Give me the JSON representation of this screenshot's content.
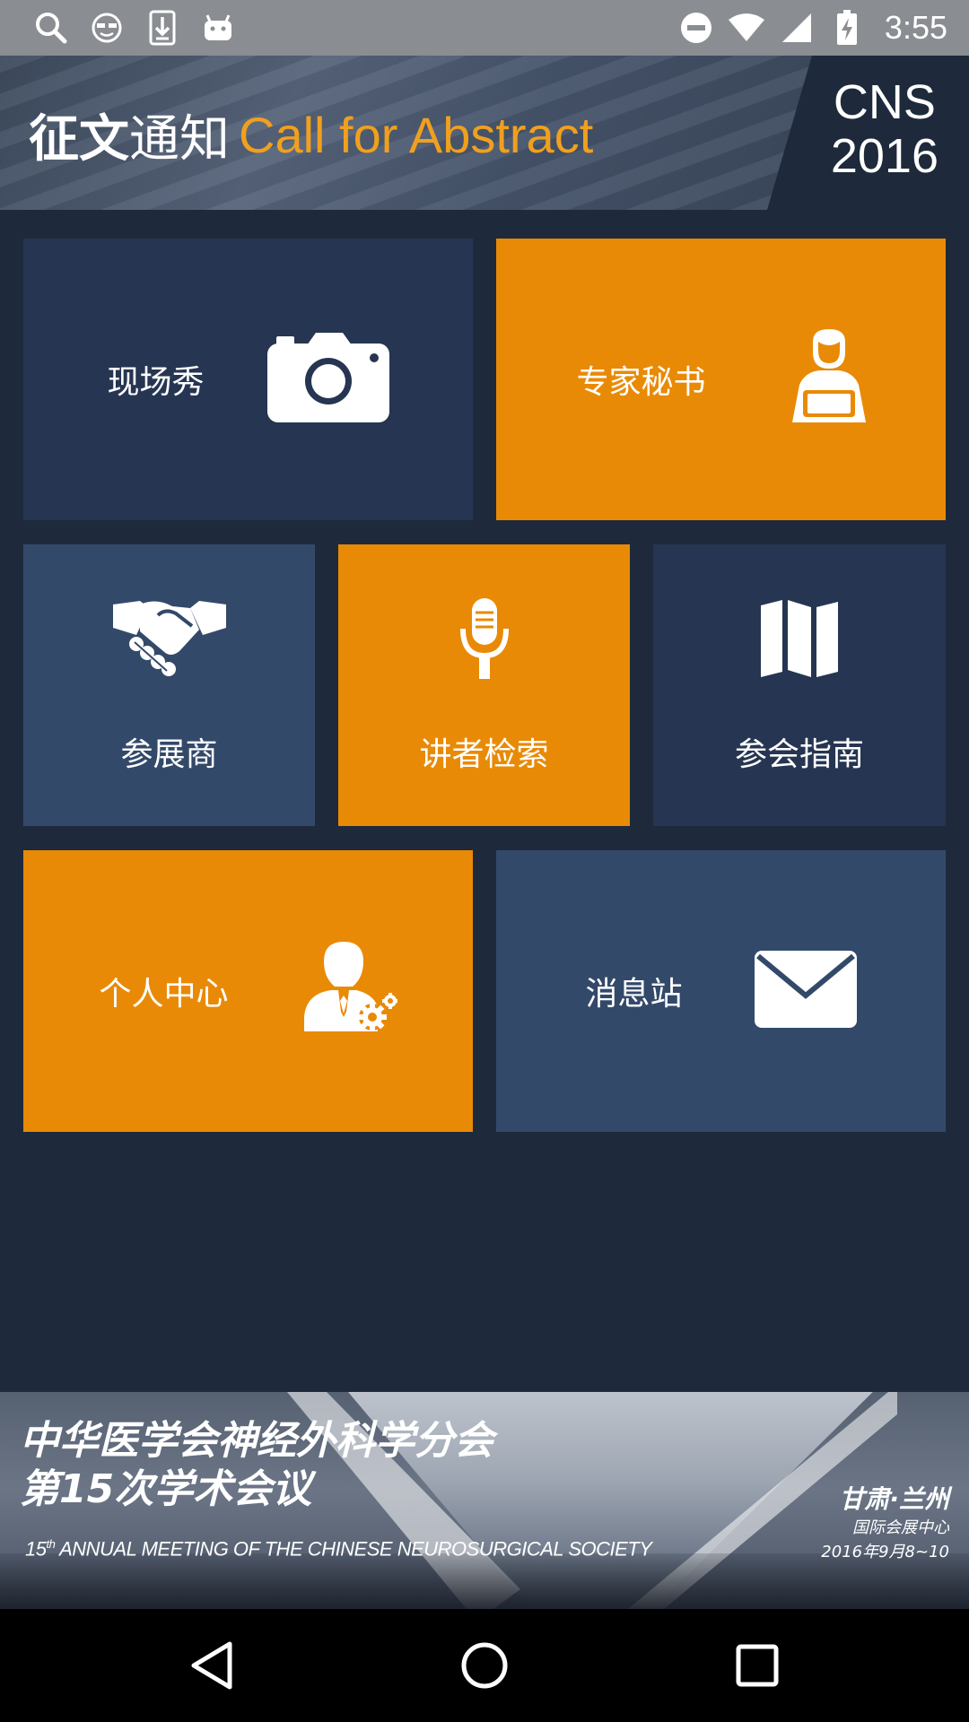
{
  "status_bar": {
    "icons_left": [
      "search-icon",
      "glasses-face-icon",
      "download-icon",
      "android-icon"
    ],
    "icons_right": [
      "do-not-disturb-icon",
      "wifi-icon",
      "signal-icon",
      "battery-charging-icon"
    ],
    "time": "3:55"
  },
  "header": {
    "title_bold": "征文",
    "title_light": "通知",
    "title_en": "Call for Abstract",
    "badge_line1": "CNS",
    "badge_line2": "2016",
    "colors": {
      "accent": "#f0a01e",
      "text": "#ffffff"
    }
  },
  "tiles": [
    {
      "id": "live-show",
      "label": "现场秀",
      "icon": "camera-icon",
      "color": "#263551"
    },
    {
      "id": "expert-secretary",
      "label": "专家秘书",
      "icon": "secretary-icon",
      "color": "#e98a06"
    },
    {
      "id": "exhibitors",
      "label": "参展商",
      "icon": "handshake-icon",
      "color": "#33496a"
    },
    {
      "id": "speaker-search",
      "label": "讲者检索",
      "icon": "microphone-icon",
      "color": "#e98a06"
    },
    {
      "id": "attendee-guide",
      "label": "参会指南",
      "icon": "map-icon",
      "color": "#263551"
    },
    {
      "id": "personal-center",
      "label": "个人中心",
      "icon": "user-settings-icon",
      "color": "#e98a06"
    },
    {
      "id": "message-station",
      "label": "消息站",
      "icon": "envelope-icon",
      "color": "#33496a"
    }
  ],
  "banner": {
    "title_line1": "中华医学会神经外科学分会",
    "title_line2": "第15次学术会议",
    "subtitle_en_num": "15",
    "subtitle_en_sup": "th",
    "subtitle_en_text": " ANNUAL MEETING OF THE CHINESE NEUROSURGICAL SOCIETY",
    "city": "甘肃·兰州",
    "venue": "国际会展中心",
    "date": "2016年9月8~10"
  },
  "nav_bar": {
    "icons": [
      "back-icon",
      "home-icon",
      "recents-icon"
    ]
  }
}
